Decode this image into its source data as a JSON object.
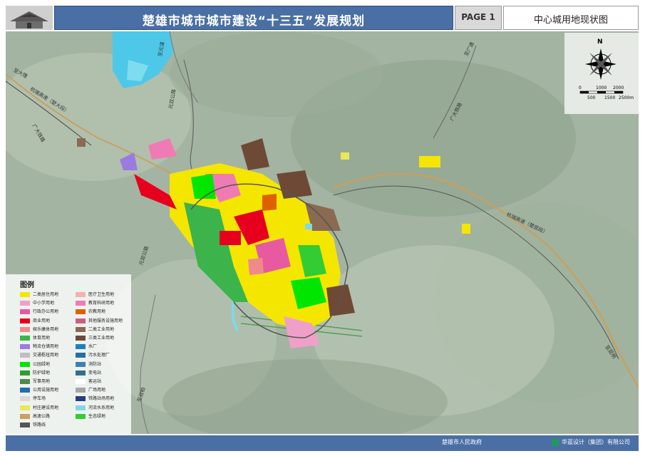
{
  "header": {
    "title": "楚雄市城市城市建设“十三五”发展规划",
    "page_label": "PAGE 1",
    "subtitle": "中心城用地现状图"
  },
  "compass": {
    "north": "N",
    "scale_top": [
      "0",
      "1000",
      "2000"
    ],
    "scale_bottom": [
      "500",
      "1500",
      "2500m"
    ]
  },
  "road_labels": [
    "至大理",
    "杭瑞高速（楚大段）",
    "广大铁路",
    "至元谋",
    "元双公路",
    "至广通",
    "广大铁路",
    "杭瑞高速（楚昆段）",
    "元双公路",
    "至双柏",
    "至昆明"
  ],
  "legend": {
    "title": "图例",
    "col1": [
      {
        "label": "二类居住用地",
        "color": "#f5e600"
      },
      {
        "label": "中小学用地",
        "color": "#f0a0c8"
      },
      {
        "label": "行政办公用地",
        "color": "#e85aa0"
      },
      {
        "label": "商业用地",
        "color": "#e6001e"
      },
      {
        "label": "娱乐康体用地",
        "color": "#f08a8a"
      },
      {
        "label": "体育用地",
        "color": "#3cb44b"
      },
      {
        "label": "物流仓储用地",
        "color": "#9b7be0"
      },
      {
        "label": "交通枢纽用地",
        "color": "#bfbfbf"
      },
      {
        "label": "公园绿地",
        "color": "#00e600"
      },
      {
        "label": "防护绿地",
        "color": "#2e9e2e"
      },
      {
        "label": "军事用地",
        "color": "#4e8a4e"
      },
      {
        "label": "公用设施用地",
        "color": "#1f6fb0"
      },
      {
        "label": "停车场",
        "color": "#d9d9d9"
      },
      {
        "label": "村庄建设用地",
        "color": "#e8e85a"
      },
      {
        "label": "高速公路",
        "color": "#c8a060"
      },
      {
        "label": "铁路线",
        "color": "#555555"
      }
    ],
    "col2": [
      {
        "label": "医疗卫生用地",
        "color": "#f5b0b0"
      },
      {
        "label": "教育科研用地",
        "color": "#f07ab4"
      },
      {
        "label": "农教用地",
        "color": "#e06000"
      },
      {
        "label": "其他服务设施用地",
        "color": "#c86080"
      },
      {
        "label": "二类工业用地",
        "color": "#8a6a50"
      },
      {
        "label": "三类工业用地",
        "color": "#6e4a36"
      },
      {
        "label": "水厂",
        "color": "#1f7fbf"
      },
      {
        "label": "污水处理厂",
        "color": "#2a6f9f"
      },
      {
        "label": "消防站",
        "color": "#3d7fb0"
      },
      {
        "label": "变电站",
        "color": "#2f6f8f"
      },
      {
        "label": "客运站",
        "color": "#ffffff"
      },
      {
        "label": "广场用地",
        "color": "#a6a6a6"
      },
      {
        "label": "铁路站场用地",
        "color": "#2a3a8a"
      },
      {
        "label": "河流水系用地",
        "color": "#7fd8e8"
      },
      {
        "label": "生态绿地",
        "color": "#33cc33"
      }
    ]
  },
  "footer": {
    "government": "楚雄市人民政府",
    "company": "华蓝设计（集团）有限公司"
  }
}
